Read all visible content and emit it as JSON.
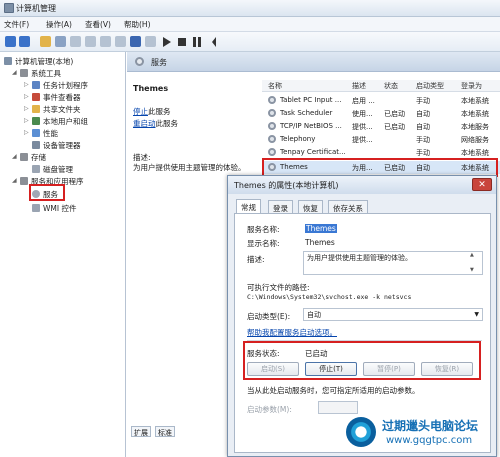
{
  "window": {
    "title": "计算机管理"
  },
  "menu": [
    "文件(F)",
    "操作(A)",
    "查看(V)",
    "帮助(H)"
  ],
  "tree": {
    "root": "计算机管理(本地)",
    "system_tools": "系统工具",
    "task_scheduler": "任务计划程序",
    "event_viewer": "事件查看器",
    "shared_folders": "共享文件夹",
    "local_users": "本地用户和组",
    "performance": "性能",
    "device_manager": "设备管理器",
    "storage": "存储",
    "disk_management": "磁盘管理",
    "services_apps": "服务和应用程序",
    "services": "服务",
    "wmi": "WMI 控件"
  },
  "header": {
    "title": "服务"
  },
  "detail": {
    "name": "Themes",
    "stop_link": "停止",
    "stop_suffix": "此服务",
    "restart_link": "重启动",
    "restart_suffix": "此服务",
    "desc_label": "描述:",
    "desc_text": "为用户提供使用主题管理的体验。"
  },
  "bottom_tabs": [
    "扩展",
    "标准"
  ],
  "list": {
    "columns": [
      "名称",
      "描述",
      "状态",
      "启动类型",
      "登录为"
    ],
    "rows": [
      {
        "name": "Tablet PC Input ...",
        "desc": "启用 ...",
        "status": "",
        "startup": "手动",
        "logon": "本地系统"
      },
      {
        "name": "Task Scheduler",
        "desc": "使用...",
        "status": "已启动",
        "startup": "自动",
        "logon": "本地系统"
      },
      {
        "name": "TCP/IP NetBIOS ...",
        "desc": "提供...",
        "status": "已启动",
        "startup": "自动",
        "logon": "本地服务"
      },
      {
        "name": "Telephony",
        "desc": "提供...",
        "status": "",
        "startup": "手动",
        "logon": "网络服务"
      },
      {
        "name": "Tenpay Certificat...",
        "desc": "",
        "status": "",
        "startup": "手动",
        "logon": "本地系统"
      },
      {
        "name": "Themes",
        "desc": "为用...",
        "status": "已启动",
        "startup": "自动",
        "logon": "本地系统"
      }
    ]
  },
  "dialog": {
    "title": "Themes 的属性(本地计算机)",
    "close": "✕",
    "tabs": [
      "常规",
      "登录",
      "恢复",
      "依存关系"
    ],
    "service_name_label": "服务名称:",
    "service_name_value": "Themes",
    "display_name_label": "显示名称:",
    "display_name_value": "Themes",
    "desc_label": "描述:",
    "desc_value": "为用户提供使用主题管理的体验。",
    "path_label": "可执行文件的路径:",
    "path_value": "C:\\Windows\\System32\\svchost.exe -k netsvcs",
    "startup_label": "启动类型(E):",
    "startup_value": "自动",
    "help_link": "帮助我配置服务启动选项。",
    "status_label": "服务状态:",
    "status_value": "已启动",
    "buttons": {
      "start": "启动(S)",
      "stop": "停止(T)",
      "pause": "暂停(P)",
      "resume": "恢复(R)"
    },
    "start_hint": "当从此处启动服务时，您可指定所适用的启动参数。",
    "params_label": "启动参数(M):"
  },
  "watermark": {
    "title": "过期邋头电脑论坛",
    "url": "www.gqgtpc.com"
  },
  "colors": {
    "highlight": "#d62020",
    "link": "#0645ad",
    "header": "#c6d4e6"
  }
}
